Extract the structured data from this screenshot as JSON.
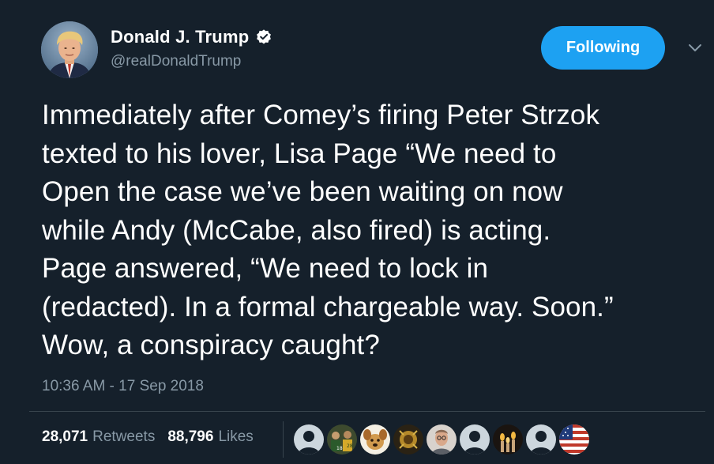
{
  "tweet": {
    "author": {
      "display_name": "Donald J. Trump",
      "handle": "@realDonaldTrump",
      "verified": true,
      "avatar_icon": "profile-photo"
    },
    "follow_button_label": "Following",
    "menu_icon": "chevron-down-icon",
    "text": "Immediately after Comey’s firing Peter Strzok\ntexted to his lover, Lisa Page “We need to\nOpen the case we’ve been waiting on now\nwhile Andy (McCabe, also fired) is acting.\nPage answered, “We need to lock in\n(redacted). In a formal chargeable way. Soon.”\nWow, a conspiracy caught?",
    "timestamp": "10:36 AM - 17 Sep 2018",
    "stats": {
      "retweets_count": "28,071",
      "retweets_label": "Retweets",
      "likes_count": "88,796",
      "likes_label": "Likes"
    },
    "liker_avatars": [
      "default-avatar",
      "group-photo-avatar",
      "dog-avatar",
      "dark-photo-avatar",
      "person-avatar",
      "default-avatar",
      "candle-avatar",
      "default-avatar",
      "us-flag-avatar"
    ]
  },
  "colors": {
    "background": "#15202b",
    "accent": "#1da1f2",
    "secondary_text": "#8899a6",
    "divider": "#38444d"
  }
}
